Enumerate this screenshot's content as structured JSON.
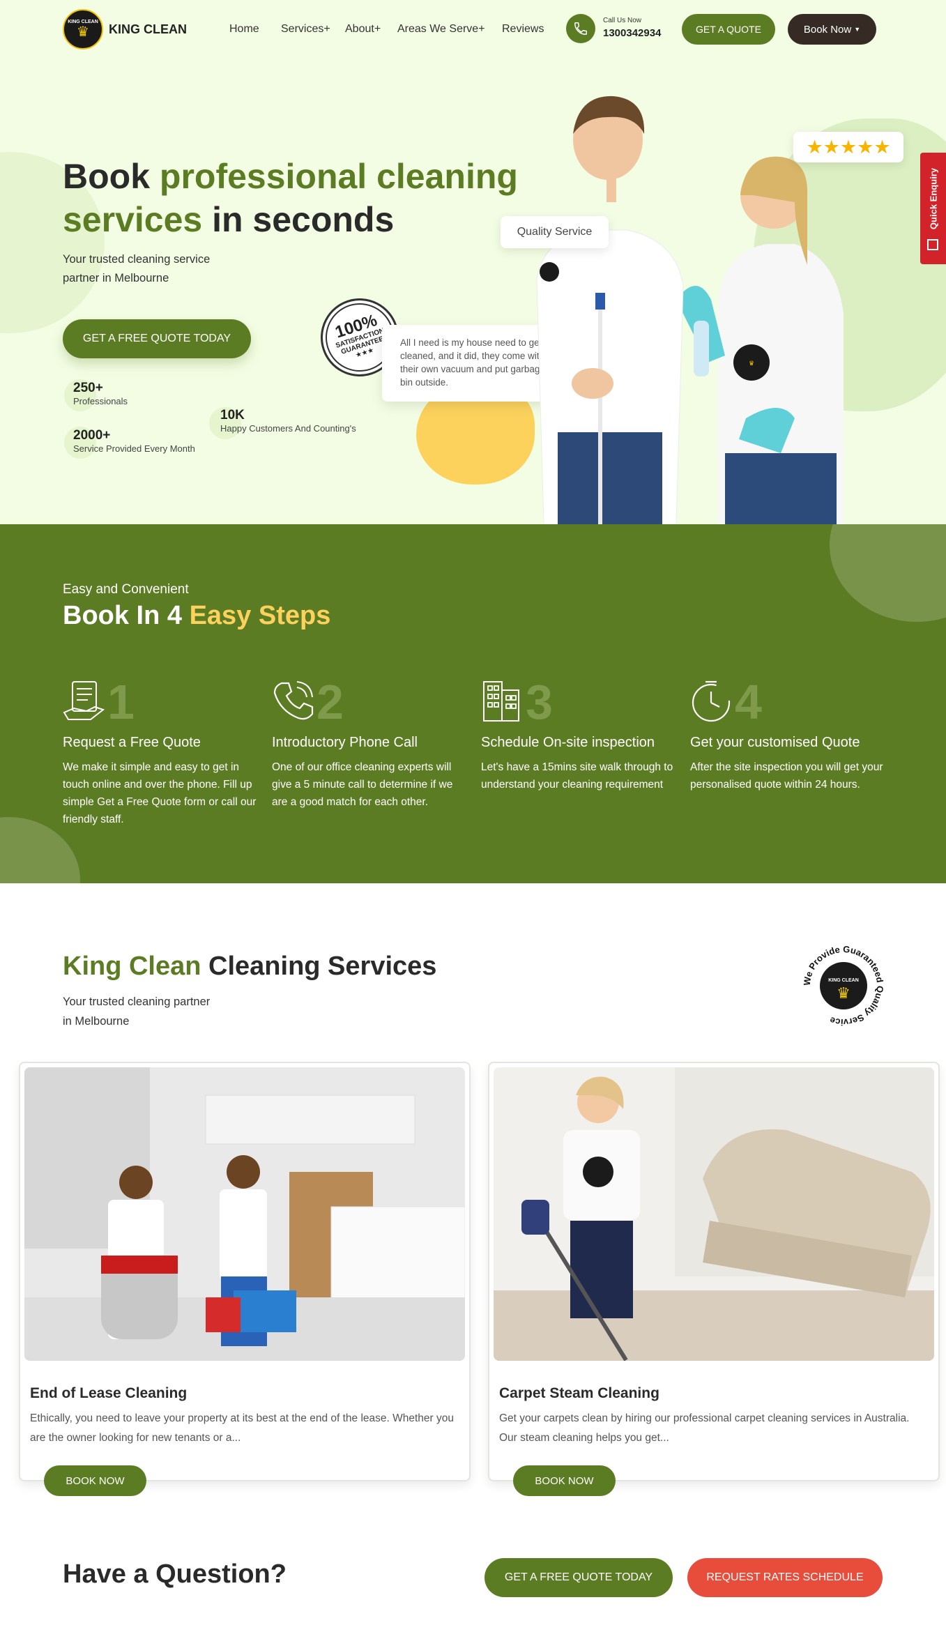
{
  "colors": {
    "brand_green": "#5c7c24",
    "hero_bg": "#f3fde3",
    "accent_yellow": "#fcd25d",
    "dark": "#352a24",
    "red": "#e84d3b"
  },
  "header": {
    "logo": {
      "text": "KING CLEAN",
      "badge_text": "KING CLEAN",
      "icon": "crown-icon"
    },
    "nav": [
      {
        "label": "Home"
      },
      {
        "label": "Services+"
      },
      {
        "label": "About+"
      },
      {
        "label": "Areas We Serve+"
      },
      {
        "label": "Reviews"
      }
    ],
    "call": {
      "caption": "Call Us Now",
      "number": "1300342934",
      "icon": "phone-icon"
    },
    "quote_button": "GET A QUOTE",
    "book_button": "Book Now",
    "book_icon": "chevron-down-icon"
  },
  "hero": {
    "title_part1": "Book ",
    "title_highlight": "professional cleaning services",
    "title_part2": " in seconds",
    "subtitle_line1": "Your trusted cleaning service",
    "subtitle_line2": "partner in Melbourne",
    "cta": "GET A FREE QUOTE TODAY",
    "stats": [
      {
        "number": "250+",
        "label": "Professionals"
      },
      {
        "number": "2000+",
        "label": "Service Provided Every Month"
      },
      {
        "number": "10K",
        "label": "Happy Customers And Counting's"
      }
    ],
    "badge": {
      "line1": "100%",
      "line2": "SATISFACTION",
      "line3": "GUARANTEE"
    },
    "quality_label": "Quality Service",
    "rating": 5,
    "testimonial": "All I need is my house need to get cleaned, and it did, they come with their own vacuum and put garbage bin outside.",
    "quick_enquiry": "Quick Enquiry"
  },
  "steps": {
    "kicker": "Easy and Convenient",
    "title_part1": "Book In 4 ",
    "title_highlight": "Easy Steps",
    "items": [
      {
        "number": "1",
        "icon": "quote-form-icon",
        "title": "Request a Free Quote",
        "text": "We make it simple and easy to get in touch online and over the phone. Fill up simple Get a Free Quote form or call our friendly staff."
      },
      {
        "number": "2",
        "icon": "phone-call-icon",
        "title": "Introductory Phone Call",
        "text": "One of our office cleaning experts will give a 5 minute call to determine if we are a good match for each other."
      },
      {
        "number": "3",
        "icon": "building-icon",
        "title": "Schedule On-site inspection",
        "text": "Let's have a 15mins site walk through to understand your cleaning requirement"
      },
      {
        "number": "4",
        "icon": "clock-icon",
        "title": "Get your customised Quote",
        "text": "After the site inspection you will get your personalised quote within 24 hours."
      }
    ]
  },
  "services": {
    "title_highlight": "King Clean",
    "title_rest": " Cleaning Services",
    "subtitle_line1": "Your trusted cleaning partner",
    "subtitle_line2": "in Melbourne",
    "seal_text": "We Provide Guaranteed Quality Service",
    "cards": [
      {
        "title": "End of Lease Cleaning",
        "text": "Ethically, you need to leave your property at its best at the end of the lease. Whether you are the owner looking for new tenants or a...",
        "button": "BOOK NOW"
      },
      {
        "title": "Carpet Steam Cleaning",
        "text": "Get your carpets clean by hiring our professional carpet cleaning services in Australia. Our steam cleaning helps you get...",
        "button": "BOOK NOW"
      }
    ]
  },
  "question": {
    "title": "Have a Question?",
    "quote_button": "GET A FREE QUOTE TODAY",
    "rates_button": "REQUEST RATES SCHEDULE"
  }
}
